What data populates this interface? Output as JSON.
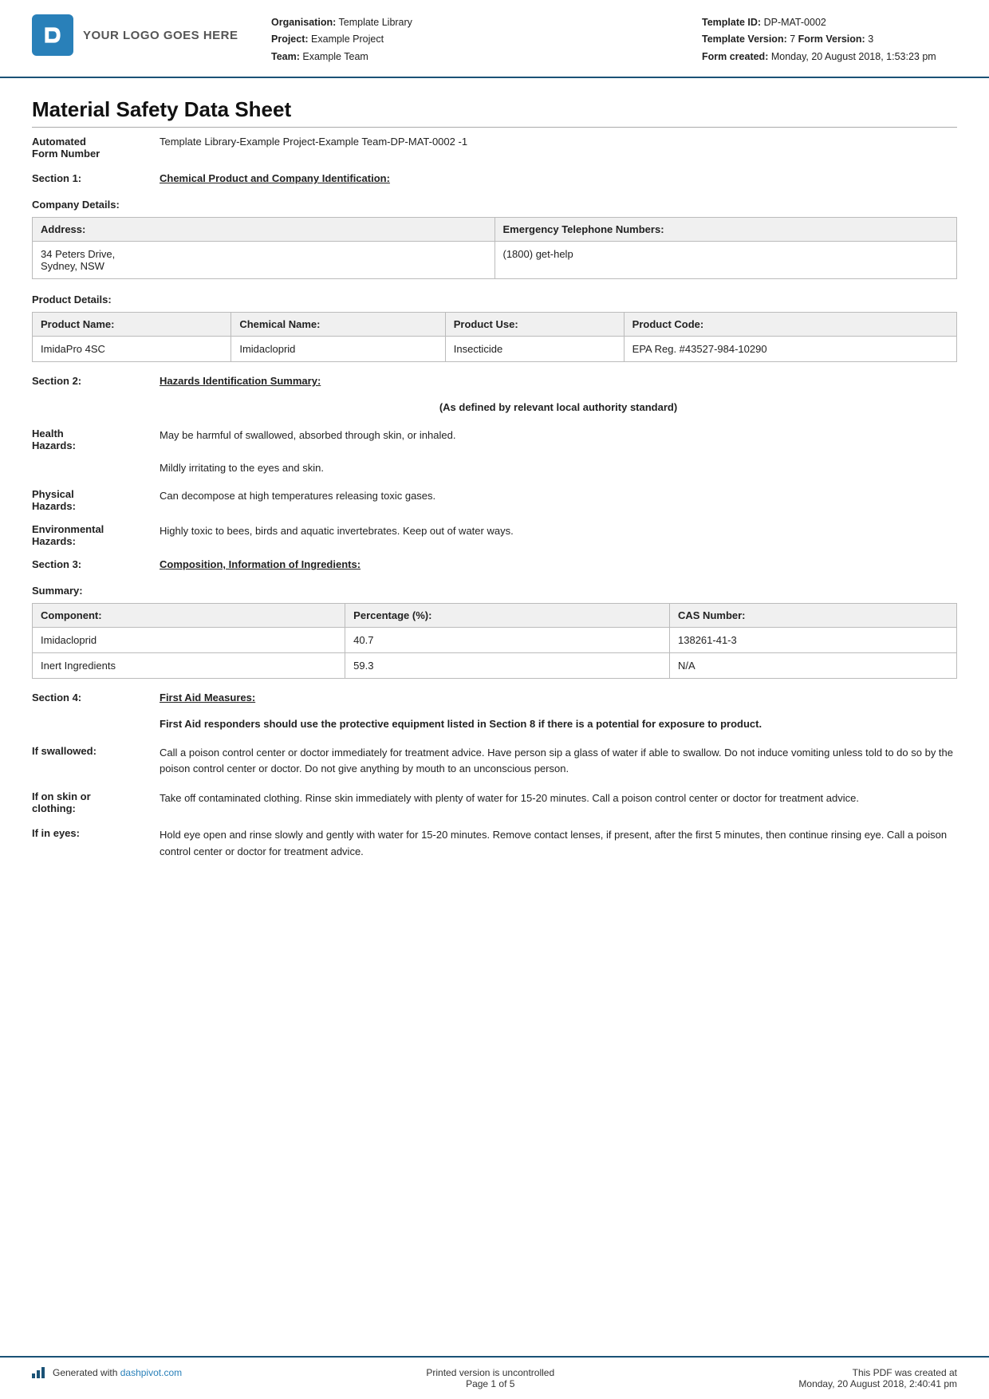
{
  "header": {
    "logo_text": "YOUR LOGO GOES HERE",
    "org_label": "Organisation:",
    "org_value": "Template Library",
    "project_label": "Project:",
    "project_value": "Example Project",
    "team_label": "Team:",
    "team_value": "Example Team",
    "template_id_label": "Template ID:",
    "template_id_value": "DP-MAT-0002",
    "template_version_label": "Template Version:",
    "template_version_value": "7",
    "form_version_label": "Form Version:",
    "form_version_value": "3",
    "form_created_label": "Form created:",
    "form_created_value": "Monday, 20 August 2018, 1:53:23 pm"
  },
  "document": {
    "title": "Material Safety Data Sheet",
    "form_number_label": "Automated\nForm Number",
    "form_number_value": "Template Library-Example Project-Example Team-DP-MAT-0002   -1"
  },
  "section1": {
    "label": "Section 1:",
    "title": "Chemical Product and Company Identification:",
    "company_details_title": "Company Details:",
    "company_table": {
      "col1_header": "Address:",
      "col2_header": "Emergency Telephone Numbers:",
      "address": "34 Peters Drive,\nSydney, NSW",
      "phone": "(1800) get-help"
    },
    "product_details_title": "Product Details:",
    "product_table": {
      "headers": [
        "Product Name:",
        "Chemical Name:",
        "Product Use:",
        "Product Code:"
      ],
      "rows": [
        [
          "ImidaPro 4SC",
          "Imidacloprid",
          "Insecticide",
          "EPA Reg. #43527-984-10290"
        ]
      ]
    }
  },
  "section2": {
    "label": "Section 2:",
    "title": "Hazards Identification Summary:",
    "center_note": "(As defined by relevant local authority standard)",
    "hazards": [
      {
        "label": "Health\nHazards:",
        "value": "May be harmful of swallowed, absorbed through skin, or inhaled.\n\nMildly irritating to the eyes and skin."
      },
      {
        "label": "Physical\nHazards:",
        "value": "Can decompose at high temperatures releasing toxic gases."
      },
      {
        "label": "Environmental\nHazards:",
        "value": "Highly toxic to bees, birds and aquatic invertebrates. Keep out of water ways."
      }
    ]
  },
  "section3": {
    "label": "Section 3:",
    "title": "Composition, Information of Ingredients:",
    "summary_title": "Summary:",
    "table": {
      "headers": [
        "Component:",
        "Percentage (%):",
        "CAS Number:"
      ],
      "rows": [
        [
          "Imidacloprid",
          "40.7",
          "138261-41-3"
        ],
        [
          "Inert Ingredients",
          "59.3",
          "N/A"
        ]
      ]
    }
  },
  "section4": {
    "label": "Section 4:",
    "title": "First Aid Measures:",
    "note": "First Aid responders should use the protective equipment listed in Section 8 if there is a potential for exposure to product.",
    "items": [
      {
        "label": "If swallowed:",
        "value": "Call a poison control center or doctor immediately for treatment advice. Have person sip a glass of water if able to swallow. Do not induce vomiting unless told to do so by the poison control center or doctor. Do not give anything by mouth to an unconscious person."
      },
      {
        "label": "If on skin or\nclothing:",
        "value": "Take off contaminated clothing. Rinse skin immediately with plenty of water for 15-20 minutes. Call a poison control center or doctor for treatment advice."
      },
      {
        "label": "If in eyes:",
        "value": "Hold eye open and rinse slowly and gently with water for 15-20 minutes. Remove contact lenses, if present, after the first 5 minutes, then continue rinsing eye. Call a poison control center or doctor for treatment advice."
      }
    ]
  },
  "footer": {
    "generated_text": "Generated with",
    "dashpivot_link": "dashpivot.com",
    "uncontrolled_text": "Printed version is uncontrolled",
    "page_text": "Page 1 of 5",
    "pdf_created_label": "This PDF was created at",
    "pdf_created_value": "Monday, 20 August 2018, 2:40:41 pm"
  }
}
